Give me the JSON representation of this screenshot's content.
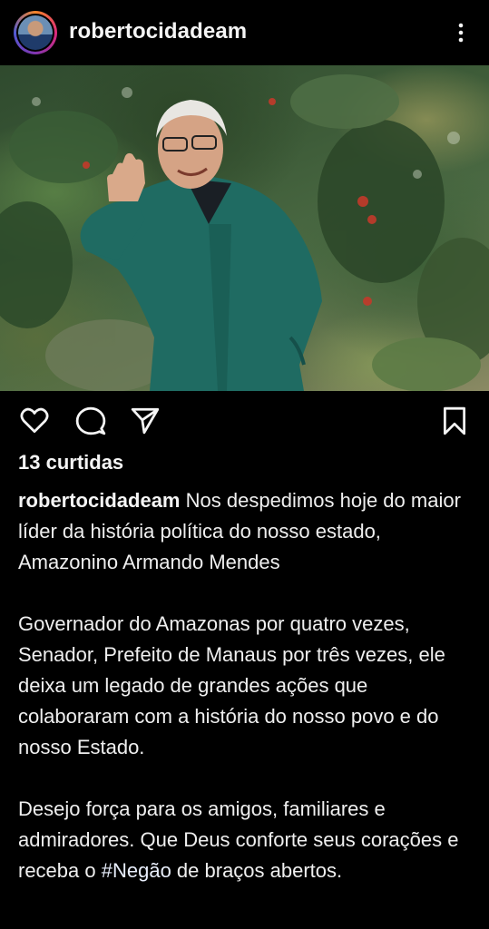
{
  "header": {
    "username": "robertocidadeam",
    "avatar_icon": "profile-avatar",
    "more_icon": "more-vertical-icon"
  },
  "post": {
    "image_icon": "post-photo"
  },
  "actions": {
    "like_icon": "heart-icon",
    "comment_icon": "comment-icon",
    "share_icon": "send-icon",
    "save_icon": "bookmark-icon"
  },
  "likes_text": "13 curtidas",
  "caption": {
    "username": "robertocidadeam",
    "paragraph1": "Nos despedimos hoje do maior líder da história política do nosso estado, Amazonino Armando Mendes",
    "paragraph2": "Governador do Amazonas por quatro vezes, Senador, Prefeito de Manaus por três vezes, ele deixa um legado de grandes ações que colaboraram com a história do nosso povo e do nosso Estado.",
    "paragraph3_before": "Desejo força para os amigos, familiares e admiradores. Que Deus conforte seus corações e receba o ",
    "hashtag": "#Negão",
    "paragraph3_after": " de braços abertos."
  },
  "colors": {
    "background": "#000000",
    "text": "#f2f2f2",
    "avatar_ring": "#dd2a7b"
  }
}
